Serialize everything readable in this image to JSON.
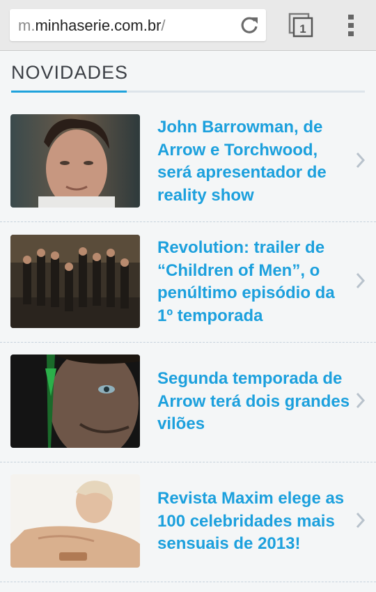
{
  "browser": {
    "url_prefix": "m.",
    "url_domain": "minhaserie.com.br",
    "url_suffix": "/",
    "tab_count": "1"
  },
  "section": {
    "title": "NOVIDADES"
  },
  "articles": [
    {
      "headline": "John Barrowman, de Arrow e Torchwood, será apresentador de reality show"
    },
    {
      "headline": "Revolution: trailer de “Children of Men”, o penúltimo episódio da 1º temporada"
    },
    {
      "headline": "Segunda temporada de Arrow terá dois grandes vilões"
    },
    {
      "headline": "Revista Maxim elege as 100 celebridades mais sensuais de 2013!"
    }
  ],
  "colors": {
    "accent": "#1fa2dc",
    "headline": "#1ca0dd",
    "title": "#3b3f45"
  }
}
